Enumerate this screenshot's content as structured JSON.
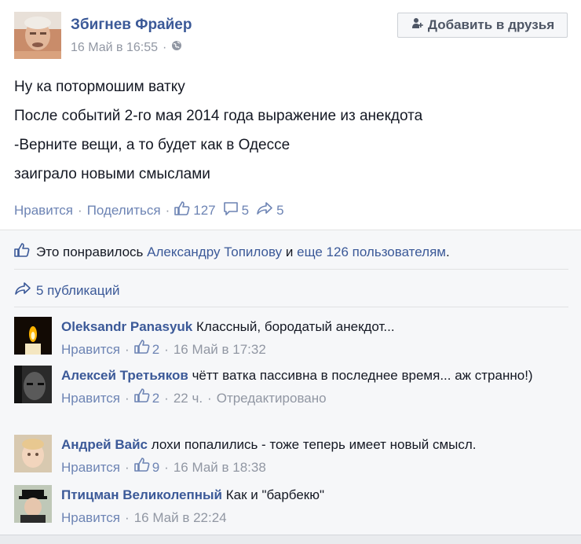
{
  "post": {
    "author": "Збигнев Фрайер",
    "timestamp": "16 Май в 16:55",
    "privacy_icon": "globe-icon",
    "add_friend_label": "Добавить в друзья",
    "lines": [
      "Ну ка потормошим ватку",
      "После событий 2-го мая 2014 года выражение из анекдота",
      "-Верните вещи, а то будет как в Одессе",
      "заиграло новыми смыслами"
    ],
    "like_label": "Нравится",
    "share_label": "Поделиться",
    "likes_count": "127",
    "comments_count": "5",
    "shares_count": "5"
  },
  "likes_summary": {
    "prefix": "Это понравилось ",
    "person": "Александру Топилову",
    "middle": " и ",
    "others": "еще 126 пользователям",
    "suffix": "."
  },
  "shares_summary": "5 публикаций",
  "comments": [
    {
      "name": "Oleksandr Panasyuk",
      "text": "Классный, бородатый анекдот...",
      "like_label": "Нравится",
      "likes": "2",
      "time": "16 Май в 17:32",
      "edited": ""
    },
    {
      "name": "Алексей Третьяков",
      "text": "чётт ватка пассивна в последнее время... аж странно!)",
      "like_label": "Нравится",
      "likes": "2",
      "time": "22 ч.",
      "edited": "Отредактировано"
    },
    {
      "name": "Андрей Вайс",
      "text": "лохи попалились - тоже теперь имеет новый смысл.",
      "like_label": "Нравится",
      "likes": "9",
      "time": "16 Май в 18:38",
      "edited": ""
    },
    {
      "name": "Птицман Великолепный",
      "text": "Как и \"барбекю\"",
      "like_label": "Нравится",
      "likes": "",
      "time": "16 Май в 22:24",
      "edited": ""
    }
  ],
  "colors": {
    "link": "#3b5998",
    "muted": "#9197a3",
    "ufi_bg": "#f6f7f9"
  }
}
